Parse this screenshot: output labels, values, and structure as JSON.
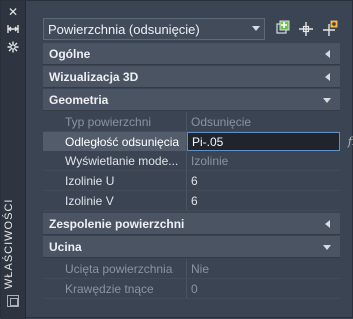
{
  "palette_title": "WŁAŚCIWOŚCI",
  "selector": {
    "value": "Powierzchnia (odsunięcie)"
  },
  "icons": {
    "close": "close-icon",
    "autohide": "autohide-icon",
    "settings": "settings-icon",
    "quick_select": "quick-select-icon",
    "select_objects": "select-objects-icon",
    "pickadd": "pickadd-toggle-icon",
    "fx": "fx"
  },
  "sections": [
    {
      "title": "Ogólne",
      "state": "collapsed"
    },
    {
      "title": "Wizualizacja 3D",
      "state": "collapsed"
    },
    {
      "title": "Geometria",
      "state": "expanded",
      "rows": [
        {
          "label": "Typ powierzchni",
          "value": "Odsunięcie",
          "readonly": true
        },
        {
          "label": "Odległość odsunięcia",
          "value": "Pi-.05",
          "active": true
        },
        {
          "label": "Wyświetlanie mode...",
          "value": "Izolinie",
          "readonly": true
        },
        {
          "label": "Izolinie U",
          "value": "6"
        },
        {
          "label": "Izolinie V",
          "value": "6"
        }
      ]
    },
    {
      "title": "Zespolenie powierzchni",
      "state": "collapsed"
    },
    {
      "title": "Ucina",
      "state": "expanded",
      "rows": [
        {
          "label": "Ucięta powierzchnia",
          "value": "Nie",
          "readonly": true
        },
        {
          "label": "Krawędzie tnące",
          "value": "0",
          "readonly": true
        }
      ]
    }
  ]
}
